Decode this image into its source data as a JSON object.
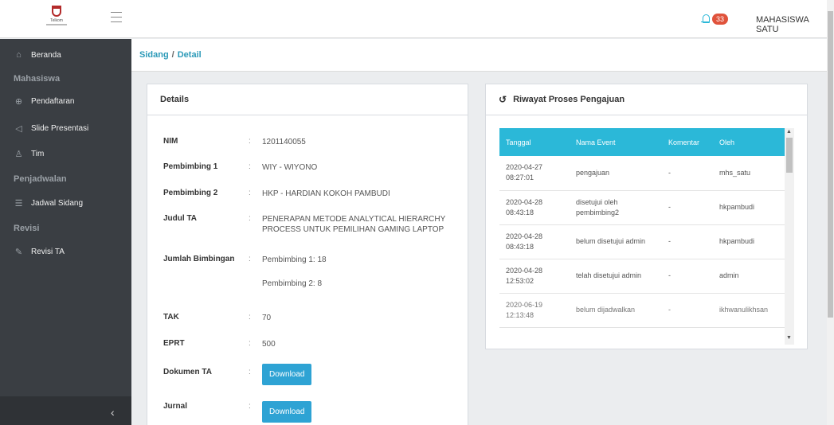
{
  "header": {
    "logo_text": "Telkom",
    "notification_count": "33",
    "username": "MAHASISWA SATU"
  },
  "sidebar": {
    "items": [
      {
        "label": "Beranda",
        "icon": "home-icon"
      },
      {
        "label": "Pendaftaran",
        "icon": "plus-circle-icon"
      },
      {
        "label": "Slide Presentasi",
        "icon": "send-icon"
      },
      {
        "label": "Tim",
        "icon": "user-icon"
      },
      {
        "label": "Jadwal Sidang",
        "icon": "list-icon"
      },
      {
        "label": "Revisi TA",
        "icon": "edit-icon"
      }
    ],
    "sections": [
      "Mahasiswa",
      "Penjadwalan",
      "Revisi"
    ],
    "collapse_icon": "chevron-left-icon"
  },
  "breadcrumb": {
    "parent": "Sidang",
    "current": "Detail"
  },
  "details": {
    "title": "Details",
    "nim_label": "NIM",
    "nim": "1201140055",
    "p1_label": "Pembimbing 1",
    "p1": "WIY - WIYONO",
    "p2_label": "Pembimbing 2",
    "p2": "HKP - HARDIAN KOKOH PAMBUDI",
    "judul_label": "Judul TA",
    "judul": "PENERAPAN METODE ANALYTICAL HIERARCHY PROCESS UNTUK PEMILIHAN GAMING LAPTOP",
    "jumlah_label": "Jumlah Bimbingan",
    "jumlah_1": "Pembimbing 1: 18",
    "jumlah_2": "Pembimbing 2: 8",
    "tak_label": "TAK",
    "tak": "70",
    "eprt_label": "EPRT",
    "eprt": "500",
    "dokumen_label": "Dokumen TA",
    "dokumen_btn": "Download",
    "jurnal_label": "Jurnal",
    "jurnal_btn": "Download",
    "colon": ":"
  },
  "history": {
    "title": "Riwayat Proses Pengajuan",
    "columns": [
      "Tanggal",
      "Nama Event",
      "Komentar",
      "Oleh"
    ],
    "rows": [
      {
        "tanggal": "2020-04-27 08:27:01",
        "event": "pengajuan",
        "komentar": "-",
        "oleh": "mhs_satu"
      },
      {
        "tanggal": "2020-04-28 08:43:18",
        "event": "disetujui oleh pembimbing2",
        "komentar": "-",
        "oleh": "hkpambudi"
      },
      {
        "tanggal": "2020-04-28 08:43:18",
        "event": "belum disetujui admin",
        "komentar": "-",
        "oleh": "hkpambudi"
      },
      {
        "tanggal": "2020-04-28 12:53:02",
        "event": "telah disetujui admin",
        "komentar": "-",
        "oleh": "admin"
      },
      {
        "tanggal": "2020-06-19 12:13:48",
        "event": "belum dijadwalkan",
        "komentar": "-",
        "oleh": "ikhwanulikhsan"
      }
    ]
  },
  "colors": {
    "accent": "#2bb8d8",
    "sidebar_bg": "#3a3e43",
    "badge": "#e0533c",
    "button": "#2ea3d4"
  }
}
